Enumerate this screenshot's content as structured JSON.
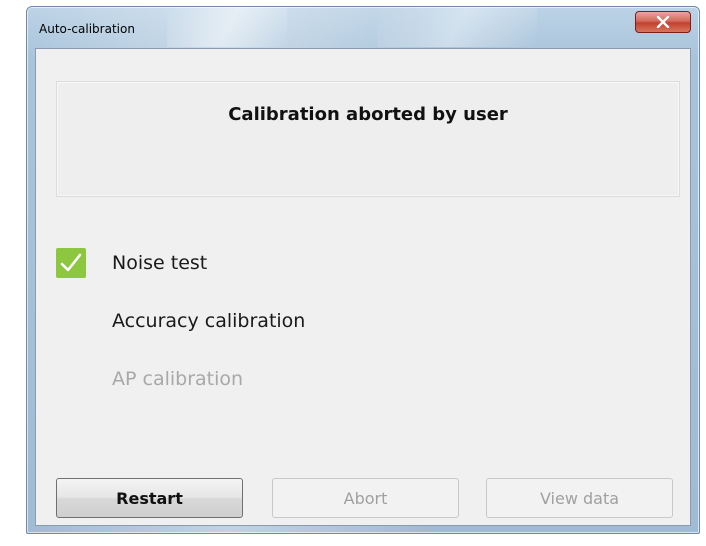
{
  "window": {
    "title": "Auto-calibration",
    "close_icon": "close-x-icon"
  },
  "status": {
    "message": "Calibration aborted by user"
  },
  "steps": [
    {
      "label": "Noise test",
      "state": "done",
      "icon": "checkmark-icon"
    },
    {
      "label": "Accuracy calibration",
      "state": "pending"
    },
    {
      "label": "AP calibration",
      "state": "disabled"
    }
  ],
  "buttons": {
    "restart": {
      "label": "Restart",
      "enabled": true
    },
    "abort": {
      "label": "Abort",
      "enabled": false
    },
    "view_data": {
      "label": "View data",
      "enabled": false
    }
  },
  "colors": {
    "check_green": "#8dc63f",
    "close_red": "#c2412f",
    "disabled_text": "#a8a8a8"
  }
}
